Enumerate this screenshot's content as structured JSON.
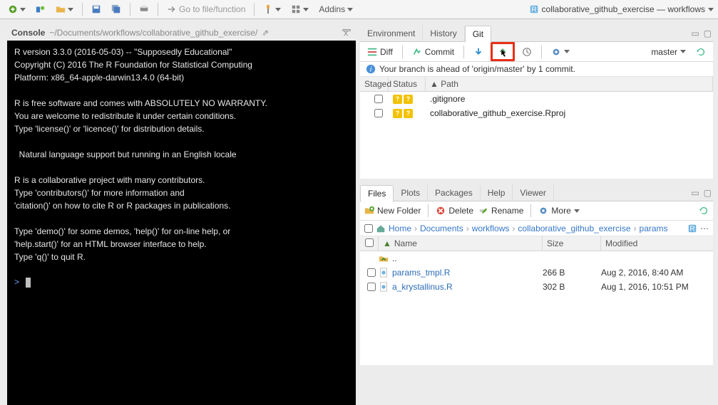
{
  "toolbar": {
    "goto": "Go to file/function",
    "addins": "Addins",
    "project_name": "collaborative_github_exercise — workflows"
  },
  "console": {
    "title": "Console",
    "path": "~/Documents/workflows/collaborative_github_exercise/",
    "body": "R version 3.3.0 (2016-05-03) -- \"Supposedly Educational\"\nCopyright (C) 2016 The R Foundation for Statistical Computing\nPlatform: x86_64-apple-darwin13.4.0 (64-bit)\n\nR is free software and comes with ABSOLUTELY NO WARRANTY.\nYou are welcome to redistribute it under certain conditions.\nType 'license()' or 'licence()' for distribution details.\n\n  Natural language support but running in an English locale\n\nR is a collaborative project with many contributors.\nType 'contributors()' for more information and\n'citation()' on how to cite R or R packages in publications.\n\nType 'demo()' for some demos, 'help()' for on-line help, or\n'help.start()' for an HTML browser interface to help.\nType 'q()' to quit R.\n",
    "prompt": ">"
  },
  "env_tabs": {
    "environment": "Environment",
    "history": "History",
    "git": "Git"
  },
  "git": {
    "diff": "Diff",
    "commit": "Commit",
    "branch": "master",
    "info": "Your branch is ahead of 'origin/master' by 1 commit.",
    "head": {
      "staged": "Staged",
      "status": "Status",
      "path": "Path"
    },
    "rows": [
      {
        "path": ".gitignore"
      },
      {
        "path": "collaborative_github_exercise.Rproj"
      }
    ]
  },
  "files_tabs": {
    "files": "Files",
    "plots": "Plots",
    "packages": "Packages",
    "help": "Help",
    "viewer": "Viewer"
  },
  "files": {
    "new_folder": "New Folder",
    "delete": "Delete",
    "rename": "Rename",
    "more": "More",
    "crumbs": [
      "Home",
      "Documents",
      "workflows",
      "collaborative_github_exercise",
      "params"
    ],
    "head": {
      "name": "Name",
      "size": "Size",
      "modified": "Modified"
    },
    "up": "..",
    "rows": [
      {
        "name": "params_tmpl.R",
        "size": "266 B",
        "modified": "Aug 2, 2016, 8:40 AM"
      },
      {
        "name": "a_krystallinus.R",
        "size": "302 B",
        "modified": "Aug 1, 2016, 10:51 PM"
      }
    ]
  }
}
